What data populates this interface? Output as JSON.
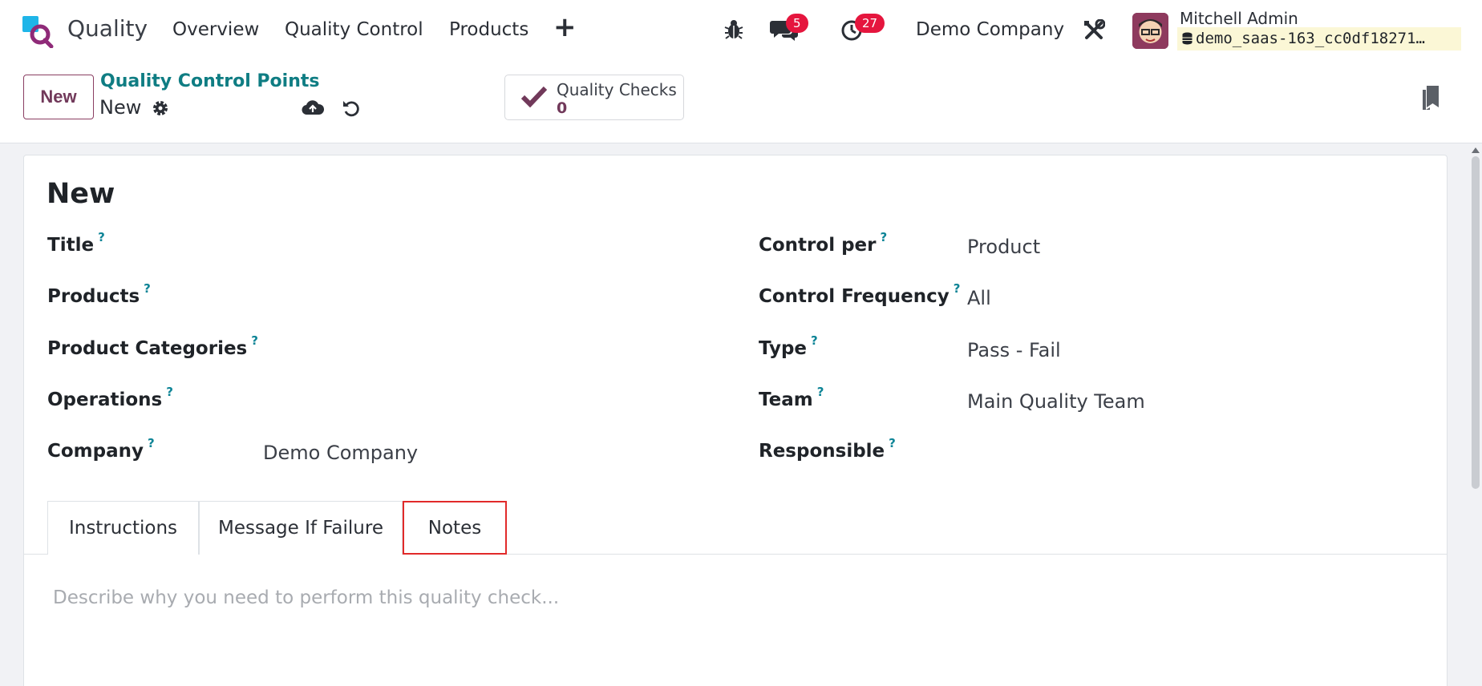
{
  "navbar": {
    "app_name": "Quality",
    "menu": [
      "Overview",
      "Quality Control",
      "Products"
    ],
    "messages_badge": "5",
    "activities_badge": "27",
    "company": "Demo Company",
    "user_name": "Mitchell Admin",
    "db_name": "demo_saas-163_cc0df18271…"
  },
  "control_panel": {
    "new_button": "New",
    "breadcrumb_parent": "Quality Control Points",
    "record_name": "New",
    "smart_button_label": "Quality Checks",
    "smart_button_value": "0"
  },
  "form": {
    "title": "New",
    "left_fields": [
      {
        "label": "Title",
        "value": ""
      },
      {
        "label": "Products",
        "value": ""
      },
      {
        "label": "Product Categories",
        "value": ""
      },
      {
        "label": "Operations",
        "value": ""
      },
      {
        "label": "Company",
        "value": "Demo Company"
      }
    ],
    "right_fields": [
      {
        "label": "Control per",
        "value": "Product"
      },
      {
        "label": "Control Frequency",
        "value": "All"
      },
      {
        "label": "Type",
        "value": "Pass - Fail"
      },
      {
        "label": "Team",
        "value": "Main Quality Team"
      },
      {
        "label": "Responsible",
        "value": ""
      }
    ],
    "help_mark": "?",
    "tabs": [
      "Instructions",
      "Message If Failure",
      "Notes"
    ],
    "notes_placeholder": "Describe why you need to perform this quality check..."
  },
  "colors": {
    "brand": "#71395a",
    "link": "#0f7d83",
    "badge": "#e5163e",
    "help": "#0d8496",
    "highlight": "#e12a2a"
  }
}
